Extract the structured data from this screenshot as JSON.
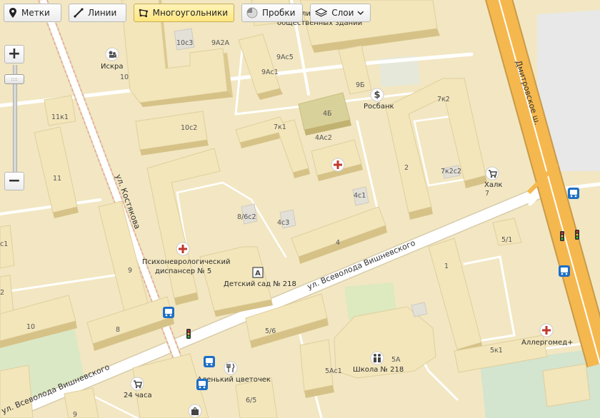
{
  "toolbar": {
    "marks": "Метки",
    "lines": "Линии",
    "polygons": "Многоугольники",
    "traffic": "Пробки",
    "layers": "Слои"
  },
  "zoom": {
    "plus": "+",
    "minus": "−",
    "knob": "::::"
  },
  "streets": {
    "dmitrovskoe": "Дмитровское ш.",
    "kostyakova": "ул. Костякова",
    "vishnevskogo_1": "ул. Всеволода Вишневского",
    "vishnevskogo_2": "ул. Всеволода Вишневского"
  },
  "poi": {
    "iskra": "Искра",
    "rosbank": "Росбанк",
    "halk": "Халк",
    "dispanser_1": "Психоневрологический",
    "dispanser_2": "диспансер № 5",
    "kindergarten": "Детский сад № 218",
    "school": "Школа № 218",
    "allergomed": "Аллергомед+",
    "flower": "Аленький цветочек",
    "hours24": "24 часа",
    "public_building": "общественных зданий",
    "public_building_prefix": "ли"
  },
  "house_numbers": {
    "h10c3": "10с3",
    "h9A2A": "9А2А",
    "h9Ac5": "9Ас5",
    "h9Ac1": "9Ас1",
    "h10": "10",
    "h9B": "9Б",
    "h4B": "4Б",
    "h7k2": "7к2",
    "h11k1": "11к1",
    "h10c2": "10с2",
    "h7k1": "7к1",
    "h4Ac2": "4Ас2",
    "h2": "2",
    "h7k2c2": "7к2с2",
    "h7": "7",
    "h11": "11",
    "h4c1": "4с1",
    "h8_6c2": "8/6с2",
    "h4c3": "4с3",
    "h4": "4",
    "h5_1": "5/1",
    "h1": "1",
    "hc1": "с1",
    "h9": "9",
    "h2left": "2",
    "h10b": "10",
    "h8": "8",
    "h5_6": "5/6",
    "h5A": "5А",
    "h5Ac1": "5Ас1",
    "h5k1": "5к1",
    "h6_5": "6/5",
    "h9b": "9"
  },
  "colors": {
    "land": "#f2e7c2",
    "building": "#f1e2b0",
    "building_top": "#f5e9c0",
    "building_side": "#ddc98f",
    "road": "#ffffff",
    "highway": "#f3b54f",
    "green": "#d9e8c8",
    "accent": "#e60000"
  },
  "icons": [
    "placemark-icon",
    "line-icon",
    "polygon-icon",
    "traffic-icon",
    "layers-icon",
    "chevron-down-icon",
    "cinema-icon",
    "bank-icon",
    "cart-icon",
    "hospital-icon",
    "kindergarten-icon",
    "school-icon",
    "bus-stop-icon",
    "traffic-light-icon",
    "restaurant-icon",
    "bag-icon"
  ]
}
